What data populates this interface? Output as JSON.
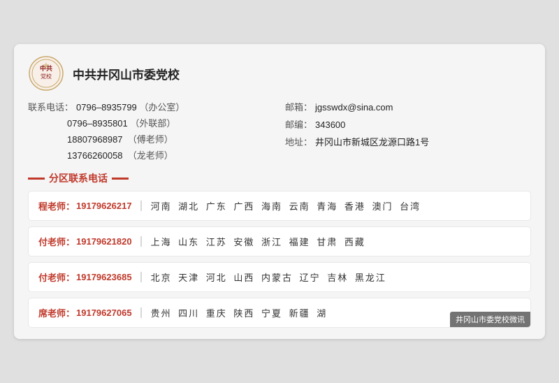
{
  "org": {
    "name": "中共井冈山市委党校",
    "logo_alt": "党校校徽"
  },
  "contacts": {
    "phone_label": "联系电话：",
    "phones": [
      {
        "value": "0796–8935799",
        "note": "（办公室）"
      },
      {
        "value": "0796–8935801",
        "note": "（外联部）"
      },
      {
        "value": "18807968987",
        "note": "（傅老师）"
      },
      {
        "value": "13766260058",
        "note": "（龙老师）"
      }
    ],
    "email_label": "邮箱：",
    "email": "jgsswdx@sina.com",
    "postcode_label": "邮编：",
    "postcode": "343600",
    "address_label": "地址：",
    "address": "井冈山市新城区龙源口路1号"
  },
  "district_section": {
    "title": "分区联系电话"
  },
  "district_contacts": [
    {
      "name": "程老师：",
      "phone": "19179626217",
      "regions": "河南  湖北  广东  广西  海南  云南  青海  香港  澳门  台湾"
    },
    {
      "name": "付老师：",
      "phone": "19179621820",
      "regions": "上海  山东  江苏  安徽  浙江  福建  甘肃  西藏"
    },
    {
      "name": "付老师：",
      "phone": "19179623685",
      "regions": "北京  天津  河北  山西  内蒙古  辽宁  吉林  黑龙江"
    },
    {
      "name": "席老师：",
      "phone": "19179627065",
      "regions": "贵州  四川  重庆  陕西  宁夏  新疆  湖..."
    }
  ],
  "watermark": {
    "text": "井冈山市委党校微讯"
  }
}
